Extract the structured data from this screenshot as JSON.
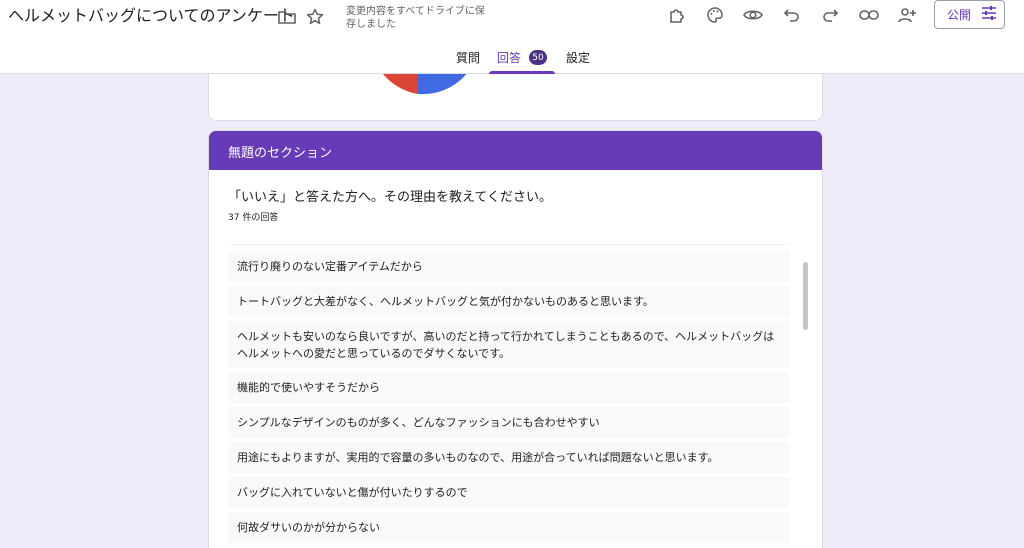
{
  "header": {
    "title": "ヘルメットバッグについてのアンケート",
    "save_status": "変更内容をすべてドライブに保存しました",
    "publish_label": "公開"
  },
  "tabs": [
    {
      "label": "質問"
    },
    {
      "label": "回答",
      "badge": "50"
    },
    {
      "label": "設定"
    }
  ],
  "section": {
    "title": "無題のセクション",
    "question": "「いいえ」と答えた方へ。その理由を教えてください。",
    "response_count": "37 件の回答",
    "responses": [
      "流行り廃りのない定番アイテムだから",
      "トートバッグと大差がなく、ヘルメットバッグと気が付かないものあると思います。",
      "ヘルメットも安いのなら良いですが、高いのだと持って行かれてしまうこともあるので、ヘルメットバッグはヘルメットへの愛だと思っているのでダサくないです。",
      "機能的で使いやすそうだから",
      "シンプルなデザインのものが多く、どんなファッションにも合わせやすい",
      "用途にもよりますが、実用的で容量の多いものなので、用途が合っていれば問題ないと思います。",
      "バッグに入れていないと傷が付いたりするので",
      "何故ダサいのかが分からない"
    ]
  },
  "colors": {
    "accent": "#673ab7",
    "background": "#f0ebf8",
    "pie_red": "#db4437",
    "pie_blue": "#4169e1"
  },
  "chart_data": {
    "type": "pie",
    "note_visible": "partially cropped pie chart; only red and blue slices visible at bottom edge"
  }
}
